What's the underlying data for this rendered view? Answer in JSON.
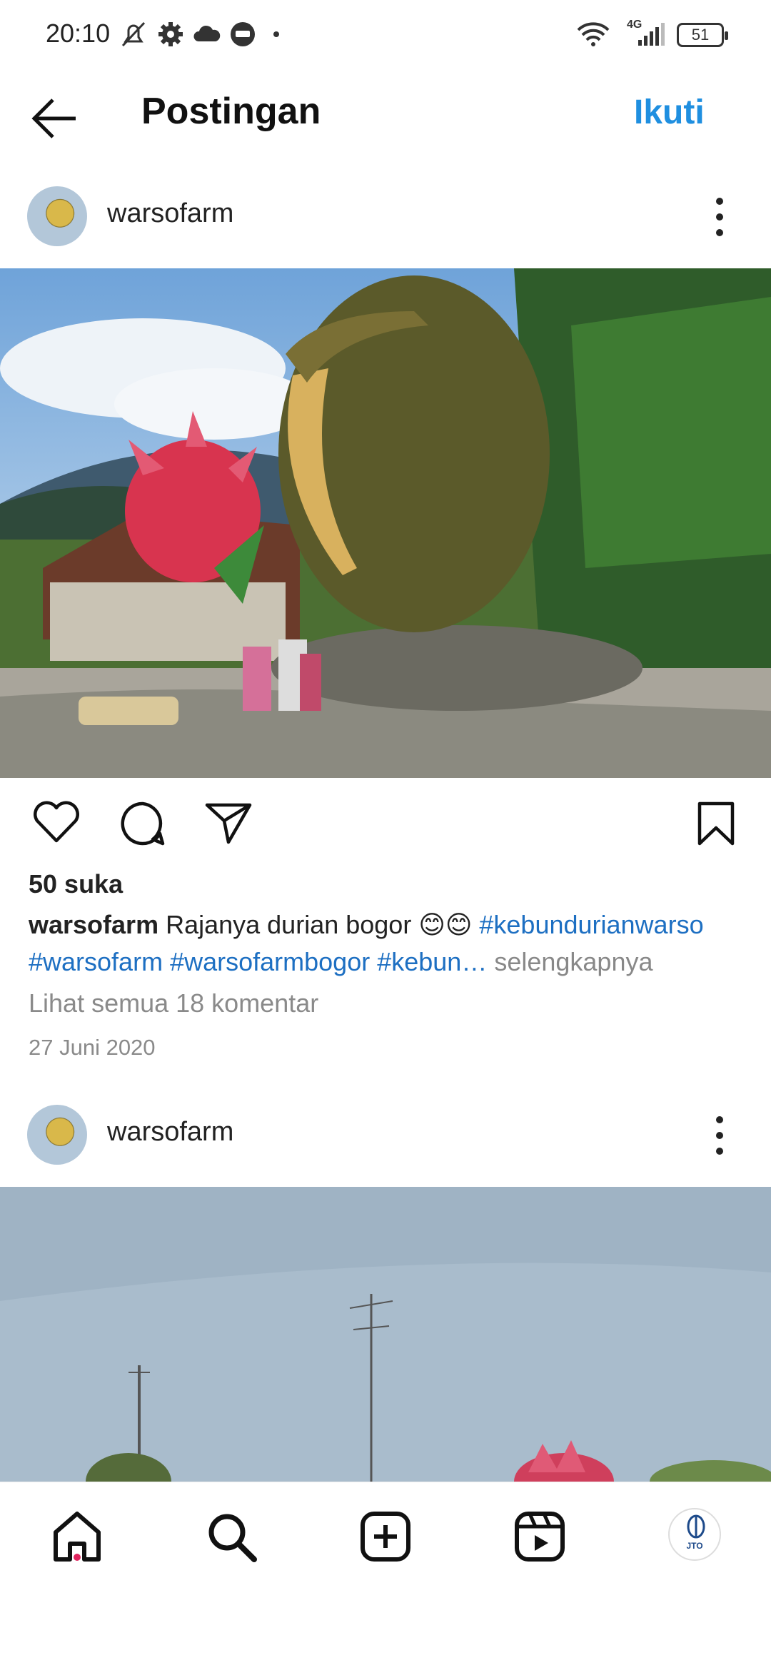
{
  "status_bar": {
    "time": "20:10",
    "network": "4G",
    "battery": "51",
    "icons": [
      "mute-icon",
      "settings-icon",
      "cloud-icon",
      "chat-icon",
      "dot-icon",
      "wifi-icon",
      "signal-icon",
      "battery-icon"
    ]
  },
  "header": {
    "title": "Postingan",
    "follow_label": "Ikuti",
    "back_icon": "back-arrow-icon"
  },
  "post1": {
    "username": "warsofarm",
    "likes": "50 suka",
    "caption_user": "warsofarm",
    "caption_text": " Rajanya durian bogor 😊😊 ",
    "tags": [
      "#kebundurianwarso",
      "#warsofarm",
      "#warsofarmbogor",
      "#kebun…"
    ],
    "more_label": " selengkapnya",
    "comments_label": "Lihat semua 18 komentar",
    "date": "27 Juni 2020"
  },
  "post2": {
    "username": "warsofarm"
  },
  "nav": {
    "items": [
      "home-icon",
      "search-icon",
      "create-icon",
      "reels-icon",
      "profile-avatar"
    ],
    "profile_label": "JTO"
  },
  "colors": {
    "accent": "#1f8fe0",
    "hashtag": "#1d6fc2",
    "notification_dot": "#e0245e"
  }
}
